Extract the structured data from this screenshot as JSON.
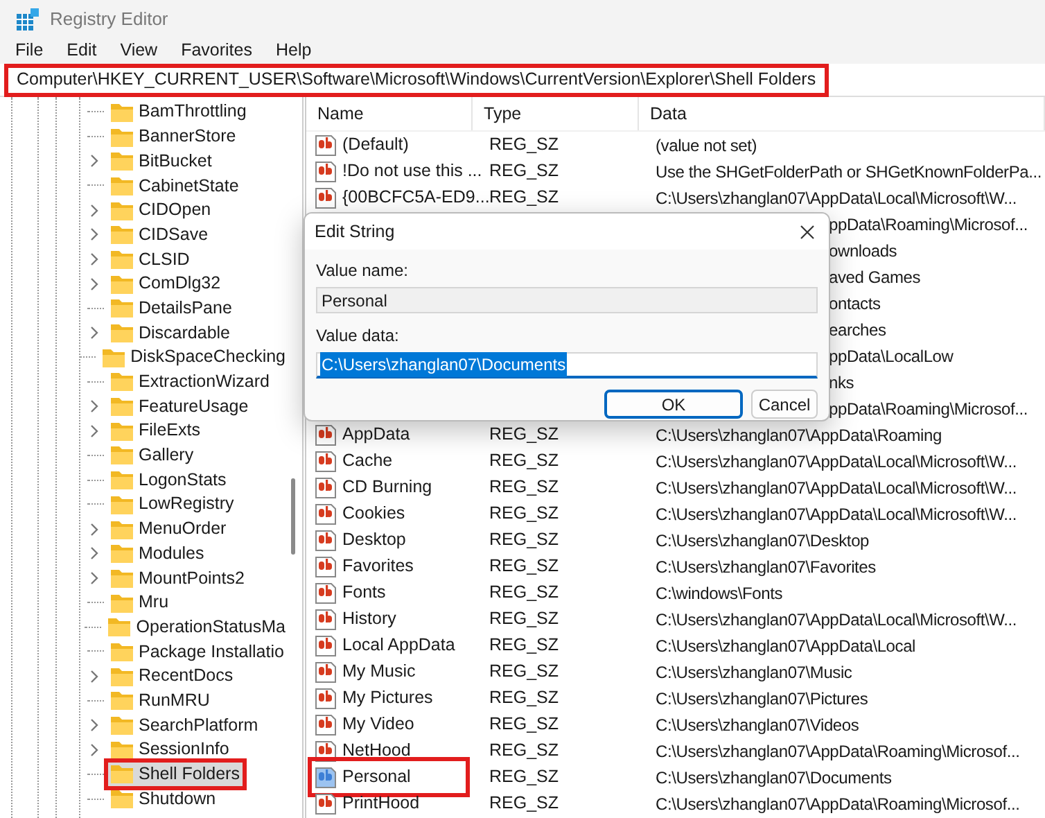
{
  "window": {
    "title": "Registry Editor"
  },
  "menu": [
    "File",
    "Edit",
    "View",
    "Favorites",
    "Help"
  ],
  "address_bar": {
    "path": "Computer\\HKEY_CURRENT_USER\\Software\\Microsoft\\Windows\\CurrentVersion\\Explorer\\Shell Folders",
    "highlighted": true
  },
  "tree": {
    "items": [
      {
        "label": "BamThrottling",
        "expandable": false,
        "selected": false,
        "highlighted": false
      },
      {
        "label": "BannerStore",
        "expandable": false,
        "selected": false,
        "highlighted": false
      },
      {
        "label": "BitBucket",
        "expandable": true,
        "selected": false,
        "highlighted": false
      },
      {
        "label": "CabinetState",
        "expandable": false,
        "selected": false,
        "highlighted": false
      },
      {
        "label": "CIDOpen",
        "expandable": true,
        "selected": false,
        "highlighted": false
      },
      {
        "label": "CIDSave",
        "expandable": true,
        "selected": false,
        "highlighted": false
      },
      {
        "label": "CLSID",
        "expandable": true,
        "selected": false,
        "highlighted": false
      },
      {
        "label": "ComDlg32",
        "expandable": true,
        "selected": false,
        "highlighted": false
      },
      {
        "label": "DetailsPane",
        "expandable": false,
        "selected": false,
        "highlighted": false
      },
      {
        "label": "Discardable",
        "expandable": true,
        "selected": false,
        "highlighted": false
      },
      {
        "label": "DiskSpaceChecking",
        "expandable": false,
        "selected": false,
        "highlighted": false
      },
      {
        "label": "ExtractionWizard",
        "expandable": false,
        "selected": false,
        "highlighted": false
      },
      {
        "label": "FeatureUsage",
        "expandable": true,
        "selected": false,
        "highlighted": false
      },
      {
        "label": "FileExts",
        "expandable": true,
        "selected": false,
        "highlighted": false
      },
      {
        "label": "Gallery",
        "expandable": false,
        "selected": false,
        "highlighted": false
      },
      {
        "label": "LogonStats",
        "expandable": false,
        "selected": false,
        "highlighted": false
      },
      {
        "label": "LowRegistry",
        "expandable": false,
        "selected": false,
        "highlighted": false
      },
      {
        "label": "MenuOrder",
        "expandable": true,
        "selected": false,
        "highlighted": false
      },
      {
        "label": "Modules",
        "expandable": true,
        "selected": false,
        "highlighted": false
      },
      {
        "label": "MountPoints2",
        "expandable": true,
        "selected": false,
        "highlighted": false
      },
      {
        "label": "Mru",
        "expandable": false,
        "selected": false,
        "highlighted": false
      },
      {
        "label": "OperationStatusMa",
        "expandable": false,
        "selected": false,
        "highlighted": false
      },
      {
        "label": "Package Installatio",
        "expandable": false,
        "selected": false,
        "highlighted": false
      },
      {
        "label": "RecentDocs",
        "expandable": true,
        "selected": false,
        "highlighted": false
      },
      {
        "label": "RunMRU",
        "expandable": false,
        "selected": false,
        "highlighted": false
      },
      {
        "label": "SearchPlatform",
        "expandable": true,
        "selected": false,
        "highlighted": false
      },
      {
        "label": "SessionInfo",
        "expandable": true,
        "selected": false,
        "highlighted": false
      },
      {
        "label": "Shell Folders",
        "expandable": false,
        "selected": true,
        "highlighted": true
      },
      {
        "label": "Shutdown",
        "expandable": false,
        "selected": false,
        "highlighted": false
      }
    ]
  },
  "table": {
    "columns": [
      "Name",
      "Type",
      "Data"
    ],
    "rows": [
      {
        "kind": "full",
        "name": "(Default)",
        "type": "REG_SZ",
        "data": "(value not set)",
        "selected": false,
        "highlighted": false
      },
      {
        "kind": "full",
        "name": "!Do not use this ...",
        "type": "REG_SZ",
        "data": "Use the SHGetFolderPath or SHGetKnownFolderPa...",
        "selected": false,
        "highlighted": false
      },
      {
        "kind": "full",
        "name": "{00BCFC5A-ED9...",
        "type": "REG_SZ",
        "data": "C:\\Users\\zhanglan07\\AppData\\Local\\Microsoft\\W...",
        "selected": false,
        "highlighted": false
      },
      {
        "kind": "covered",
        "data": "ppData\\Roaming\\Microsof..."
      },
      {
        "kind": "covered",
        "data": "ownloads"
      },
      {
        "kind": "covered",
        "data": "aved Games"
      },
      {
        "kind": "covered",
        "data": "ontacts"
      },
      {
        "kind": "covered",
        "data": "earches"
      },
      {
        "kind": "covered",
        "data": "ppData\\LocalLow"
      },
      {
        "kind": "covered",
        "data": "nks"
      },
      {
        "kind": "covered",
        "data": "ppData\\Roaming\\Microsof..."
      },
      {
        "kind": "full",
        "name": "AppData",
        "type": "REG_SZ",
        "data": "C:\\Users\\zhanglan07\\AppData\\Roaming",
        "selected": false,
        "highlighted": false
      },
      {
        "kind": "full",
        "name": "Cache",
        "type": "REG_SZ",
        "data": "C:\\Users\\zhanglan07\\AppData\\Local\\Microsoft\\W...",
        "selected": false,
        "highlighted": false
      },
      {
        "kind": "full",
        "name": "CD Burning",
        "type": "REG_SZ",
        "data": "C:\\Users\\zhanglan07\\AppData\\Local\\Microsoft\\W...",
        "selected": false,
        "highlighted": false
      },
      {
        "kind": "full",
        "name": "Cookies",
        "type": "REG_SZ",
        "data": "C:\\Users\\zhanglan07\\AppData\\Local\\Microsoft\\W...",
        "selected": false,
        "highlighted": false
      },
      {
        "kind": "full",
        "name": "Desktop",
        "type": "REG_SZ",
        "data": "C:\\Users\\zhanglan07\\Desktop",
        "selected": false,
        "highlighted": false
      },
      {
        "kind": "full",
        "name": "Favorites",
        "type": "REG_SZ",
        "data": "C:\\Users\\zhanglan07\\Favorites",
        "selected": false,
        "highlighted": false
      },
      {
        "kind": "full",
        "name": "Fonts",
        "type": "REG_SZ",
        "data": "C:\\windows\\Fonts",
        "selected": false,
        "highlighted": false
      },
      {
        "kind": "full",
        "name": "History",
        "type": "REG_SZ",
        "data": "C:\\Users\\zhanglan07\\AppData\\Local\\Microsoft\\W...",
        "selected": false,
        "highlighted": false
      },
      {
        "kind": "full",
        "name": "Local AppData",
        "type": "REG_SZ",
        "data": "C:\\Users\\zhanglan07\\AppData\\Local",
        "selected": false,
        "highlighted": false
      },
      {
        "kind": "full",
        "name": "My Music",
        "type": "REG_SZ",
        "data": "C:\\Users\\zhanglan07\\Music",
        "selected": false,
        "highlighted": false
      },
      {
        "kind": "full",
        "name": "My Pictures",
        "type": "REG_SZ",
        "data": "C:\\Users\\zhanglan07\\Pictures",
        "selected": false,
        "highlighted": false
      },
      {
        "kind": "full",
        "name": "My Video",
        "type": "REG_SZ",
        "data": "C:\\Users\\zhanglan07\\Videos",
        "selected": false,
        "highlighted": false
      },
      {
        "kind": "full",
        "name": "NetHood",
        "type": "REG_SZ",
        "data": "C:\\Users\\zhanglan07\\AppData\\Roaming\\Microsof...",
        "selected": false,
        "highlighted": false
      },
      {
        "kind": "full",
        "name": "Personal",
        "type": "REG_SZ",
        "data": "C:\\Users\\zhanglan07\\Documents",
        "selected": true,
        "highlighted": true
      },
      {
        "kind": "full",
        "name": "PrintHood",
        "type": "REG_SZ",
        "data": "C:\\Users\\zhanglan07\\AppData\\Roaming\\Microsof...",
        "selected": false,
        "highlighted": false
      }
    ]
  },
  "dialog": {
    "title": "Edit String",
    "value_name_label": "Value name:",
    "value_name": "Personal",
    "value_data_label": "Value data:",
    "value_data": "C:\\Users\\zhanglan07\\Documents",
    "buttons": [
      {
        "label": "OK",
        "selected": true
      },
      {
        "label": "Cancel",
        "selected": false
      }
    ]
  }
}
